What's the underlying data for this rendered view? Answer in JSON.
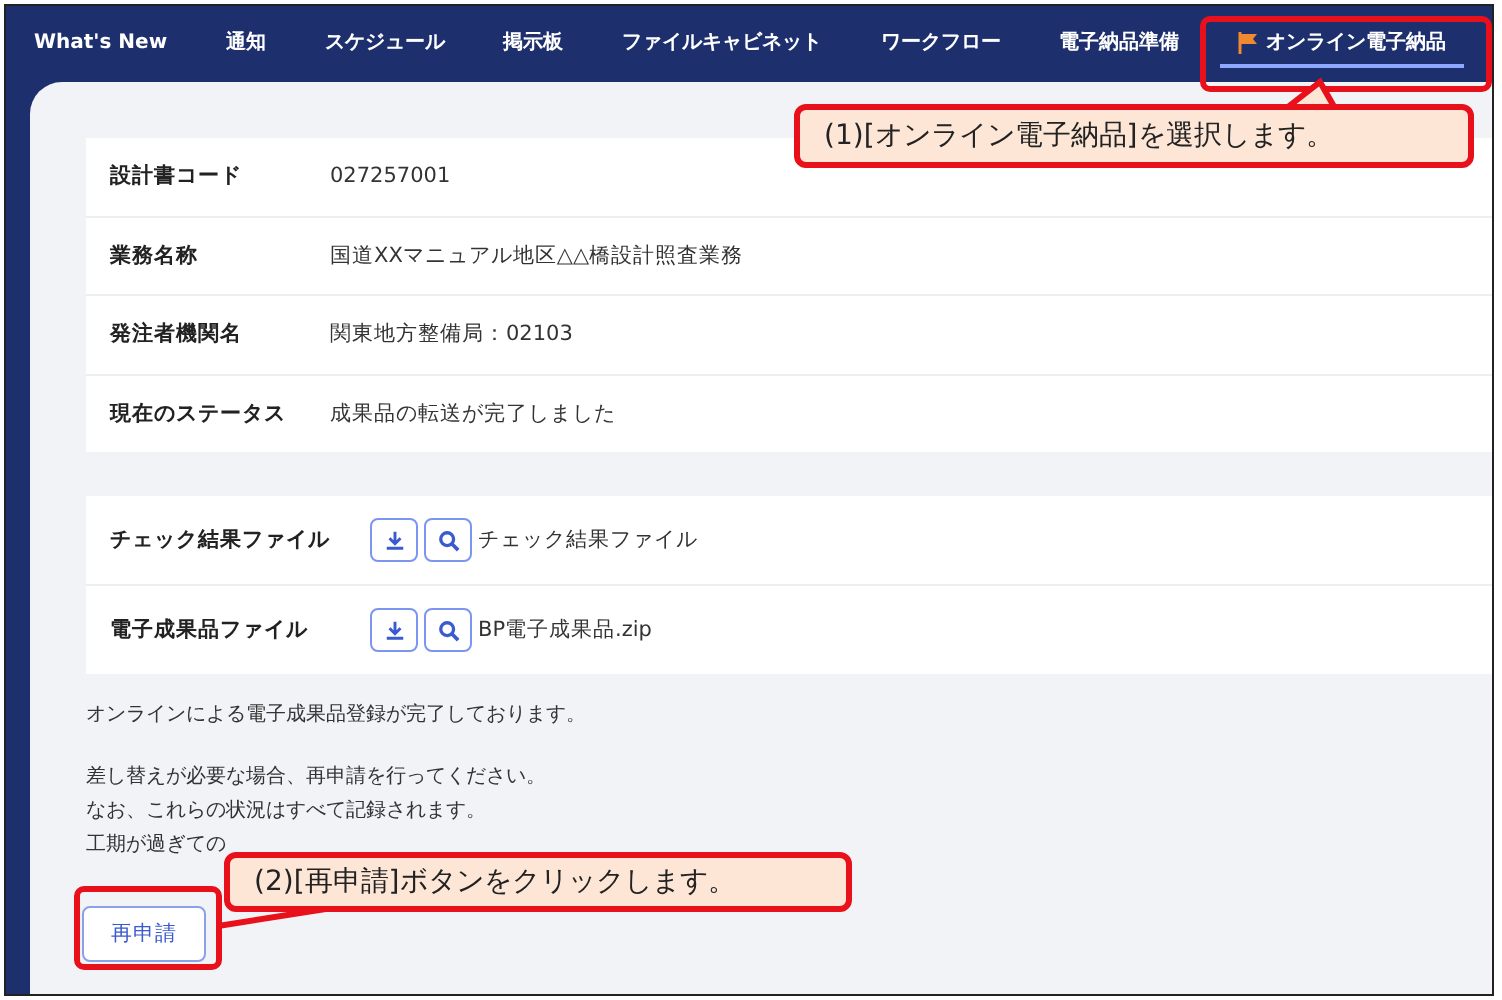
{
  "nav": {
    "tabs": [
      {
        "label": "What's New",
        "selected": false
      },
      {
        "label": "通知",
        "selected": false
      },
      {
        "label": "スケジュール",
        "selected": false
      },
      {
        "label": "掲示板",
        "selected": false
      },
      {
        "label": "ファイルキャビネット",
        "selected": false
      },
      {
        "label": "ワークフロー",
        "selected": false
      },
      {
        "label": "電子納品準備",
        "selected": false
      },
      {
        "label": "オンライン電子納品",
        "selected": true
      }
    ]
  },
  "details": [
    {
      "label": "設計書コード",
      "value": "027257001"
    },
    {
      "label": "業務名称",
      "value": "国道XXマニュアル地区△△橋設計照査業務"
    },
    {
      "label": "発注者機関名",
      "value": "関東地方整備局：02103"
    },
    {
      "label": "現在のステータス",
      "value": "成果品の転送が完了しました"
    }
  ],
  "files": [
    {
      "label": "チェック結果ファイル",
      "file": "チェック結果ファイル"
    },
    {
      "label": "電子成果品ファイル",
      "file": "BP電子成果品.zip"
    }
  ],
  "messages": [
    "オンラインによる電子成果品登録が完了しております。",
    "差し替えが必要な場合、再申請を行ってください。",
    "なお、これらの状況はすべて記録されます。",
    "工期が過ぎての"
  ],
  "reapply_button": "再申請",
  "callouts": [
    "(1)[オンライン電子納品]を選択します。",
    "(2)[再申請]ボタンをクリックします。"
  ]
}
